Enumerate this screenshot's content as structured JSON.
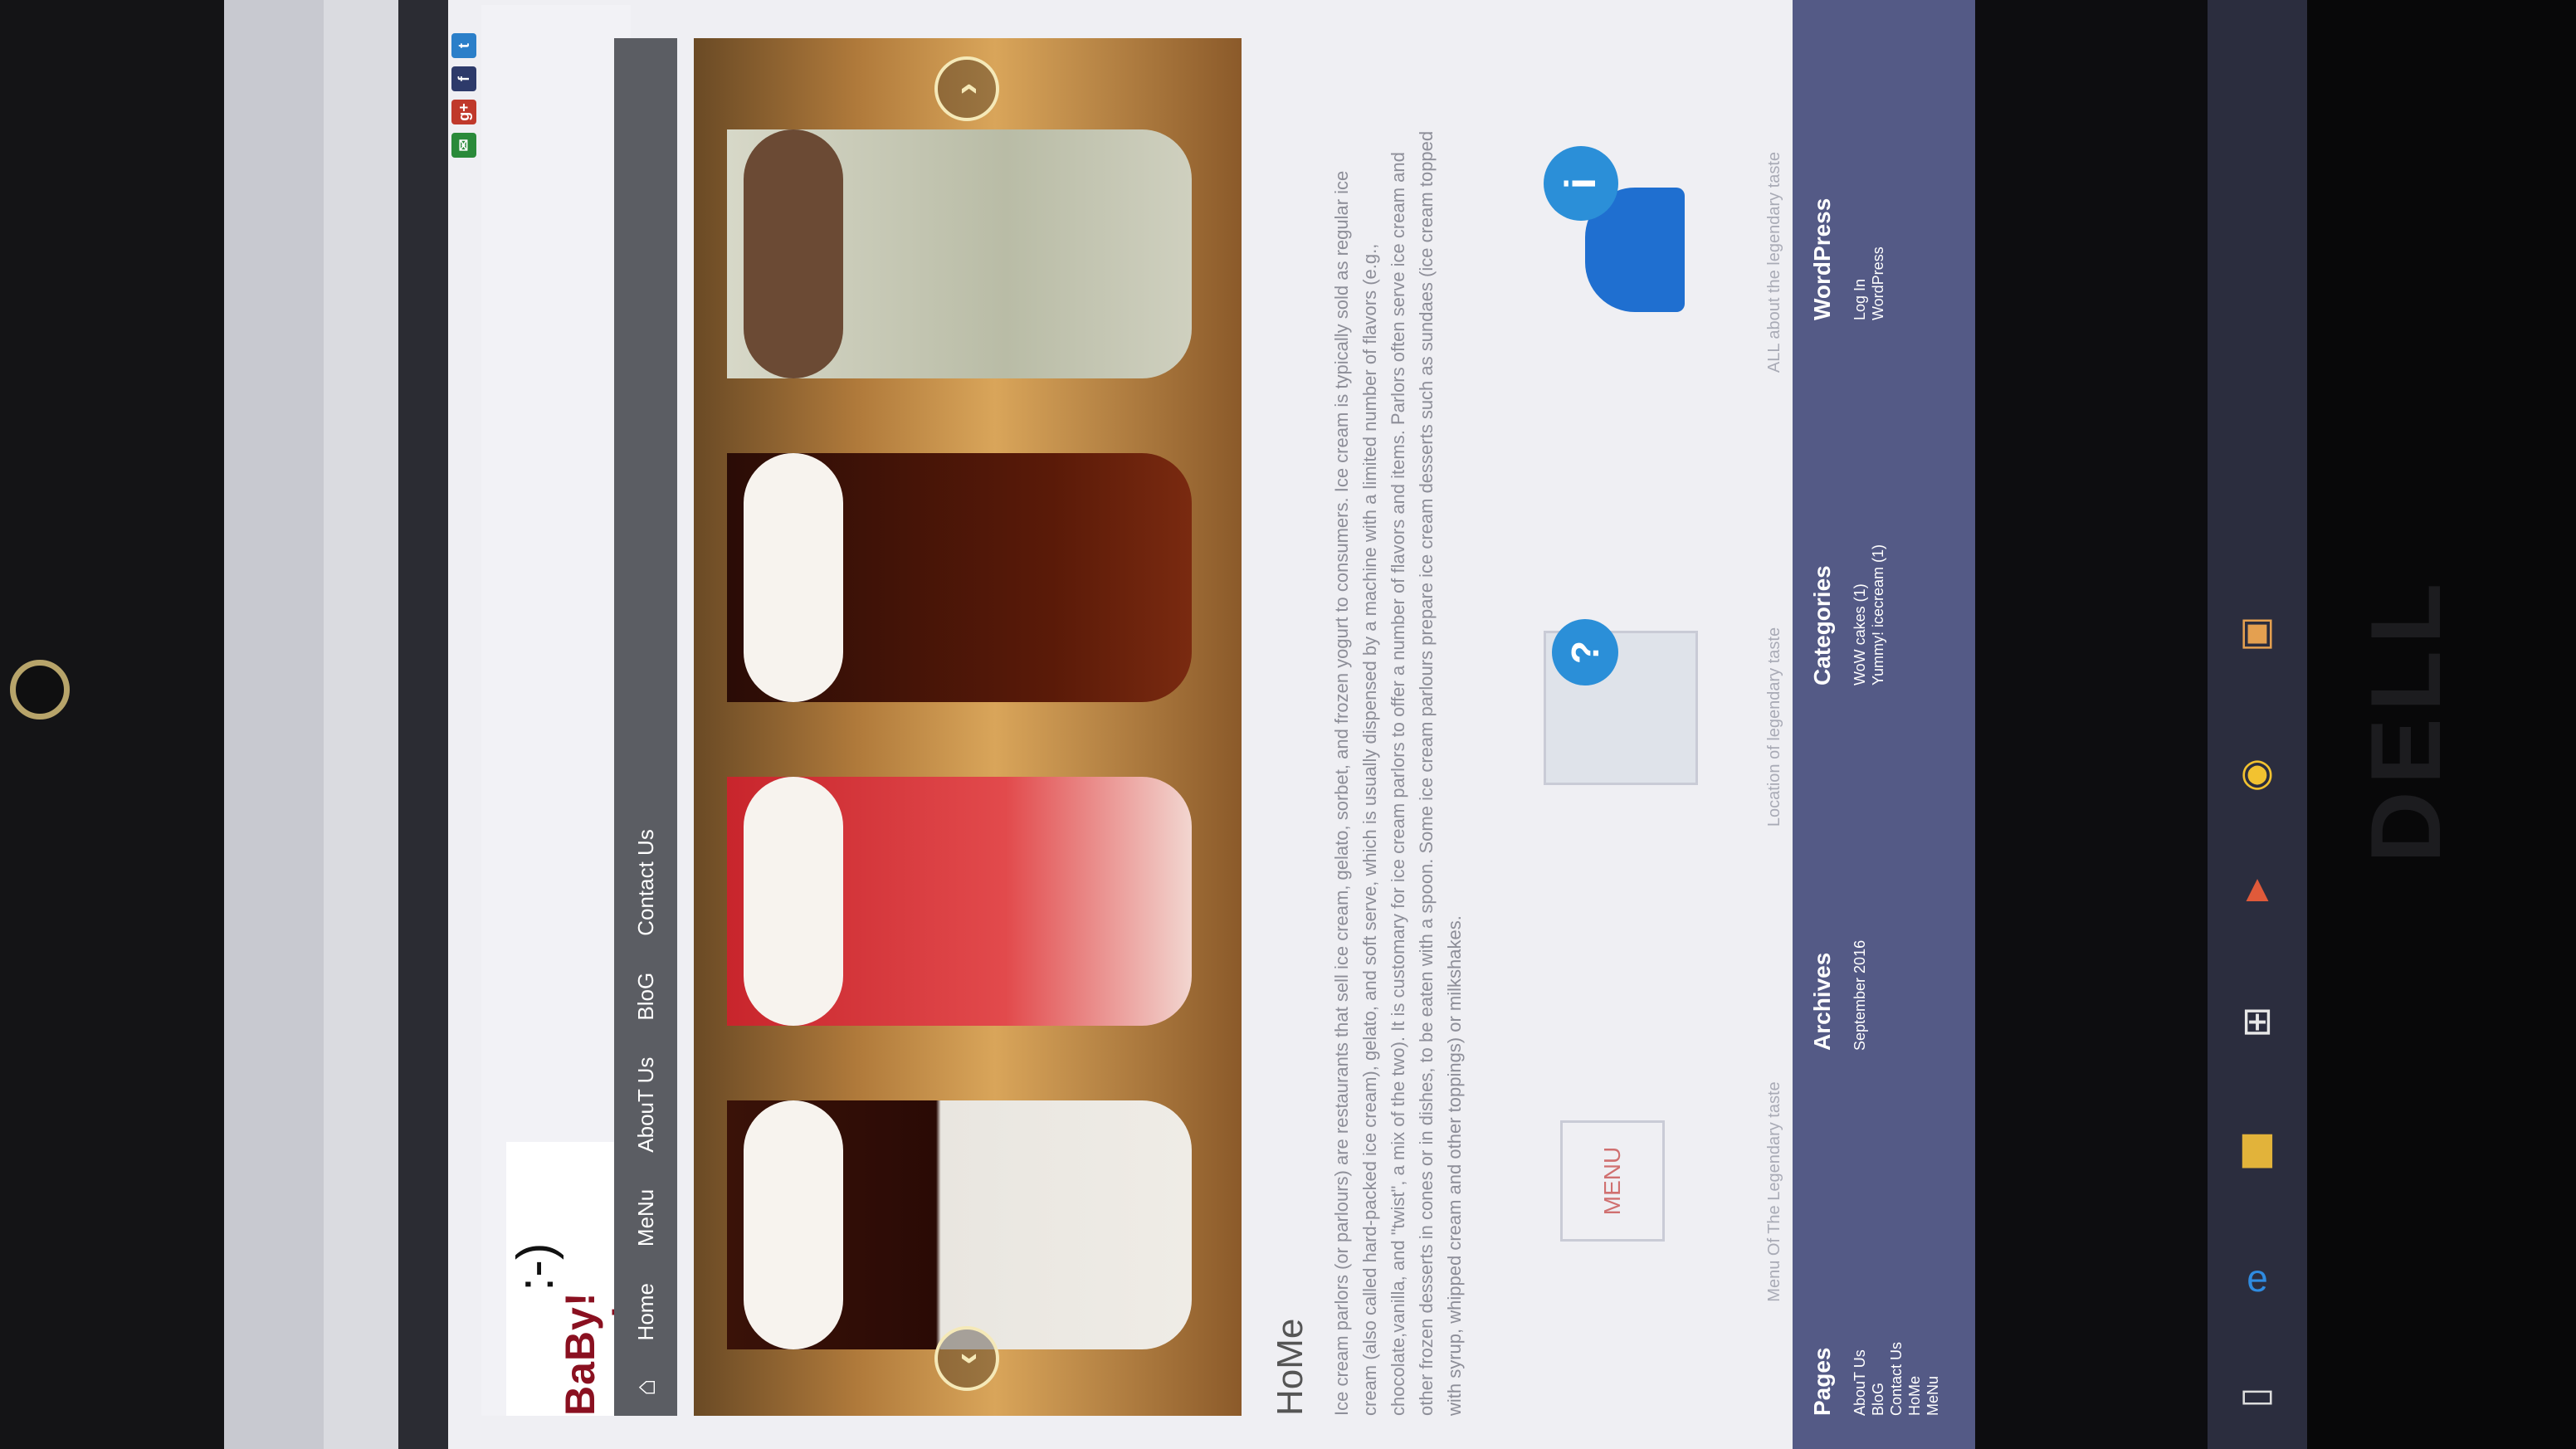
{
  "site": {
    "logo_face": ":-)",
    "logo_name": "BaBy! snacks",
    "social": [
      "✉",
      "g+",
      "f",
      "t"
    ]
  },
  "nav": {
    "home_icon": "home-icon",
    "items": [
      "Home",
      "MeNu",
      "AbouT Us",
      "BloG",
      "Contact Us"
    ]
  },
  "slider": {
    "prev": "‹",
    "next": "›"
  },
  "content": {
    "title": "HoMe",
    "body": "Ice cream parlors (or parlours) are restaurants that sell ice cream, gelato, sorbet, and frozen yogurt to consumers. Ice cream is typically sold as regular ice cream (also called hard-packed ice cream), gelato, and soft serve, which is usually dispensed by a machine with a limited number of flavors (e.g., chocolate,vanilla, and \"twist\", a mix of the two). It is customary for ice cream parlors to offer a number of flavors and items. Parlors often serve ice cream and other frozen desserts in cones or in dishes, to be eaten with a spoon. Some ice cream parlours prepare ice cream desserts such as sundaes (ice cream topped with syrup, whipped cream and other toppings) or milkshakes."
  },
  "features": [
    {
      "icon": "menu-board-icon",
      "label_icon": "MENU",
      "caption": "Menu Of The Legendary taste"
    },
    {
      "icon": "map-pin-icon",
      "label_icon": "?",
      "caption": "Location of legendary taste"
    },
    {
      "icon": "info-person-icon",
      "label_icon": "i",
      "caption": "ALL about the legendary taste"
    }
  ],
  "footer": {
    "pages": {
      "heading": "Pages",
      "items": [
        "AbouT Us",
        "BloG",
        "Contact Us",
        "HoMe",
        "MeNu"
      ]
    },
    "archives": {
      "heading": "Archives",
      "items": [
        "September 2016"
      ]
    },
    "categories": {
      "heading": "Categories",
      "items": [
        "WoW cakes (1)",
        "Yummy! icecream (1)"
      ]
    },
    "wordpress": {
      "heading": "WordPress",
      "items": [
        "Log In",
        "WordPress"
      ]
    }
  },
  "brand": "DELL",
  "colors": {
    "nav": "#5b5d63",
    "footer": "#545a86",
    "logo": "#8a1020"
  }
}
